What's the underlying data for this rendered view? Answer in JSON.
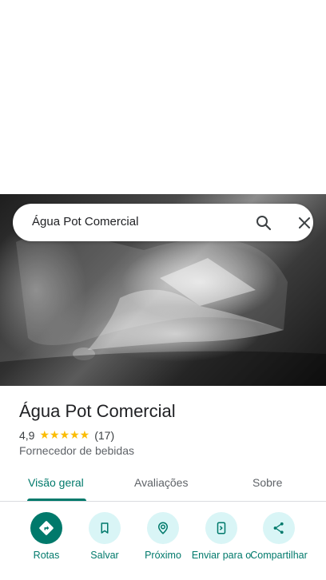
{
  "search": {
    "query": "Água Pot Comercial"
  },
  "place": {
    "name": "Água Pot Comercial",
    "rating": "4,9",
    "stars": "★★★★★",
    "reviews": "(17)",
    "category": "Fornecedor de bebidas"
  },
  "tabs": [
    {
      "label": "Visão geral"
    },
    {
      "label": "Avaliações"
    },
    {
      "label": "Sobre"
    }
  ],
  "actions": [
    {
      "label": "Rotas"
    },
    {
      "label": "Salvar"
    },
    {
      "label": "Próximo"
    },
    {
      "label": "Enviar para o"
    },
    {
      "label": "Compartilhar"
    }
  ],
  "colors": {
    "accent": "#00796b",
    "action_bg": "#d9f5f6",
    "star": "#fbbc04"
  }
}
